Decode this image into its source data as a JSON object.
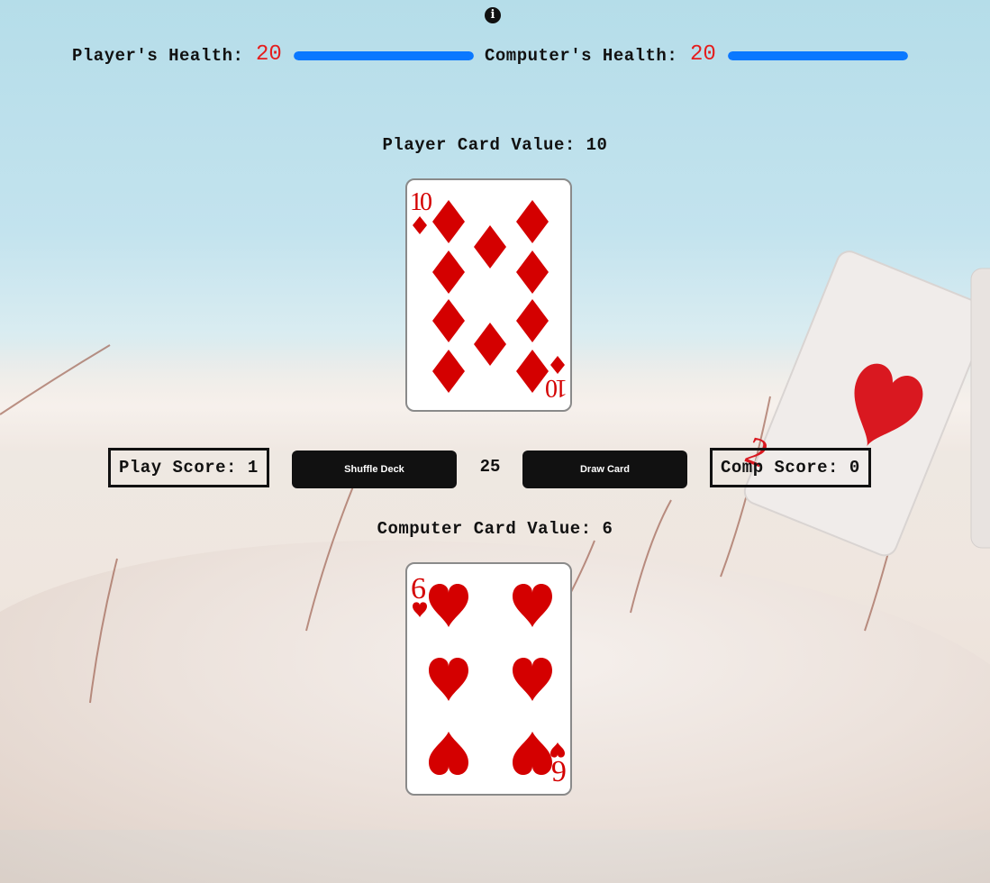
{
  "info_icon": "info-icon",
  "health": {
    "player_label": "Player's Health:",
    "player_value": "20",
    "player_fraction": 1.0,
    "computer_label": "Computer's Health:",
    "computer_value": "20",
    "computer_fraction": 1.0,
    "bar_color": "#0a78ff",
    "value_color": "#e51d1d"
  },
  "player_card": {
    "value_text": "Player Card Value: 10",
    "rank": "10",
    "suit": "diamonds",
    "color": "#d40000"
  },
  "controls": {
    "player_score": "Play Score: 1",
    "shuffle_label": "Shuffle Deck",
    "deck_count": "25",
    "draw_label": "Draw Card",
    "computer_score": "Comp Score: 0"
  },
  "computer_card": {
    "value_text": "Computer Card Value: 6",
    "rank": "6",
    "suit": "hearts",
    "color": "#d40000"
  },
  "background_card": {
    "rank": "2",
    "suit": "hearts"
  }
}
